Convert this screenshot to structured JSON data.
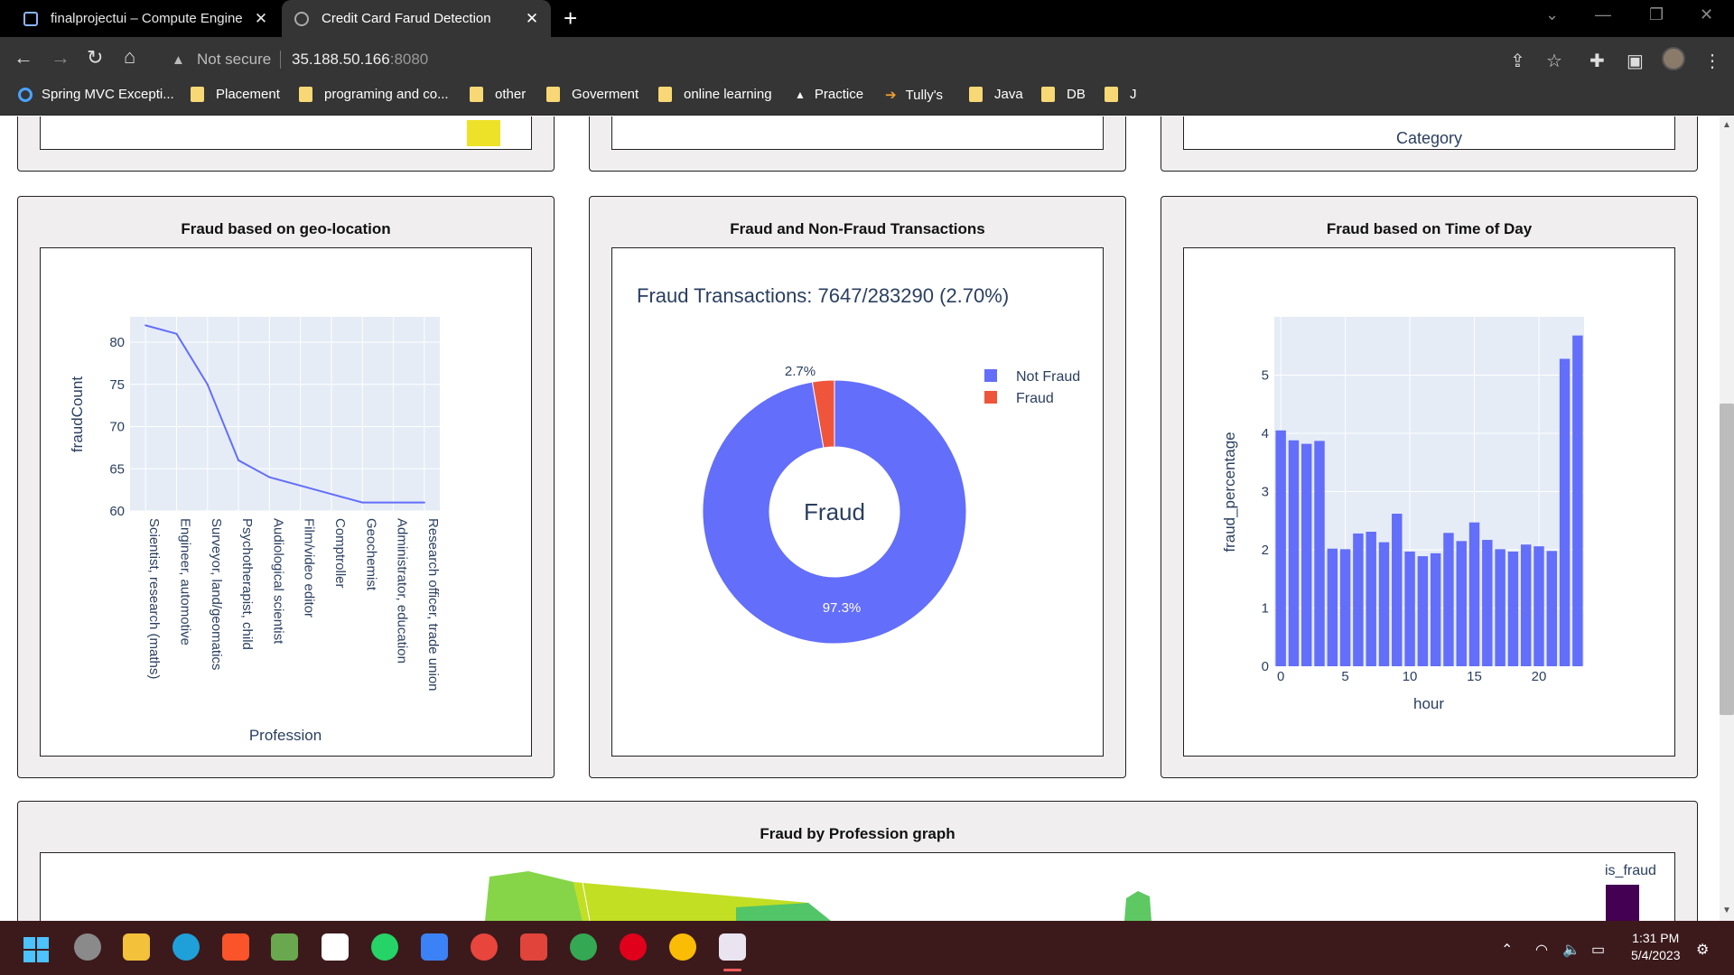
{
  "browser": {
    "tabs": [
      {
        "title": "finalprojectui – Compute Engine"
      },
      {
        "title": "Credit Card Farud Detection"
      }
    ],
    "security": "Not secure",
    "url_host": "35.188.50.166",
    "url_port": ":8080",
    "bookmarks": [
      "Spring MVC Excepti...",
      "Placement",
      "programing and co...",
      "other",
      "Goverment",
      "online learning",
      "Practice",
      "Tully's",
      "Java",
      "DB",
      "J"
    ]
  },
  "top_row": {
    "right_axis_label": "Category"
  },
  "cards": {
    "geo": {
      "title": "Fraud based on geo-location"
    },
    "pie": {
      "title": "Fraud and Non-Fraud Transactions"
    },
    "time": {
      "title": "Fraud based on Time of Day"
    },
    "map": {
      "title": "Fraud by Profession graph",
      "legend_title": "is_fraud"
    }
  },
  "chart_data": [
    {
      "type": "line",
      "xlabel": "Profession",
      "ylabel": "fraudCount",
      "categories": [
        "Scientist, research (maths)",
        "Engineer, automotive",
        "Surveyor, land/geomatics",
        "Psychotherapist, child",
        "Audiological scientist",
        "Film/video editor",
        "Comptroller",
        "Geochemist",
        "Administrator, education",
        "Research officer, trade union"
      ],
      "values": [
        82,
        81,
        75,
        66,
        64,
        63,
        62,
        61,
        61,
        61
      ],
      "yticks": [
        60,
        65,
        70,
        75,
        80
      ],
      "ylim": [
        60,
        83
      ],
      "color": "#636efa"
    },
    {
      "type": "pie",
      "title": "Fraud Transactions: 7647/283290 (2.70%)",
      "center_label": "Fraud",
      "labels": [
        "Not Fraud",
        "Fraud"
      ],
      "values": [
        97.3,
        2.7
      ],
      "value_labels": [
        "97.3%",
        "2.7%"
      ],
      "colors": [
        "#636efa",
        "#ef553b"
      ],
      "legend": "top-right"
    },
    {
      "type": "bar",
      "xlabel": "hour",
      "ylabel": "fraud_percentage",
      "x": [
        0,
        1,
        2,
        3,
        4,
        5,
        6,
        7,
        8,
        9,
        10,
        11,
        12,
        13,
        14,
        15,
        16,
        17,
        18,
        19,
        20,
        21,
        22,
        23
      ],
      "values": [
        4.05,
        3.88,
        3.82,
        3.87,
        2.02,
        2.01,
        2.28,
        2.31,
        2.13,
        2.62,
        1.97,
        1.89,
        1.94,
        2.29,
        2.15,
        2.47,
        2.17,
        2.01,
        1.97,
        2.09,
        2.06,
        1.98,
        5.28,
        5.68
      ],
      "xticks": [
        0,
        5,
        10,
        15,
        20
      ],
      "yticks": [
        0,
        1,
        2,
        3,
        4,
        5
      ],
      "ylim": [
        0,
        6
      ],
      "color": "#636efa"
    }
  ],
  "taskbar": {
    "time": "1:31 PM",
    "date": "5/4/2023"
  }
}
